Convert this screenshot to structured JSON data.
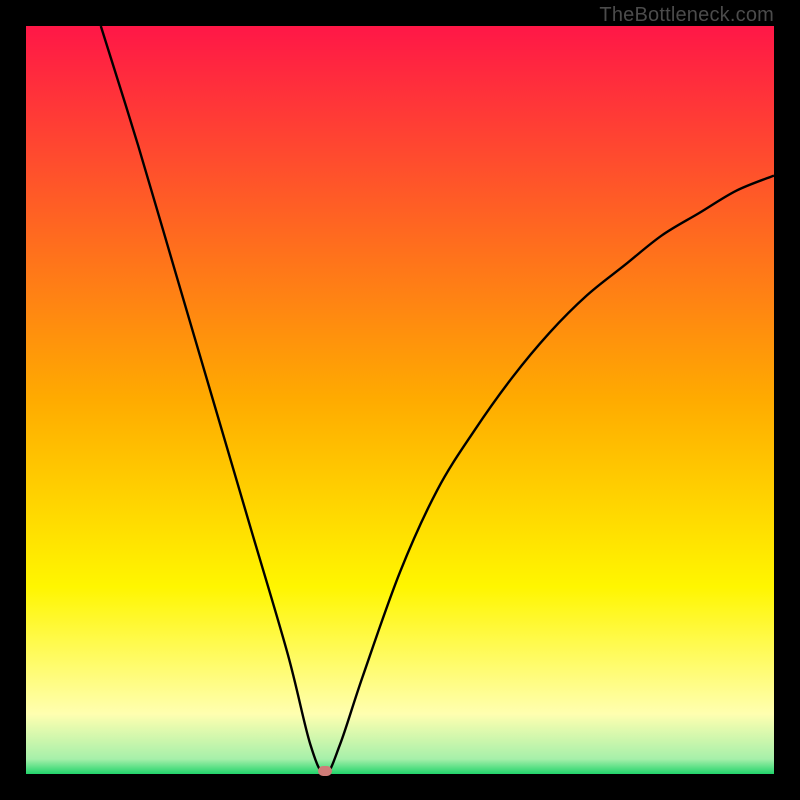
{
  "watermark": "TheBottleneck.com",
  "chart_data": {
    "type": "line",
    "title": "",
    "xlabel": "",
    "ylabel": "",
    "xlim": [
      0,
      100
    ],
    "ylim": [
      0,
      100
    ],
    "gradient": {
      "stops": [
        {
          "offset": 0,
          "color": "#ff1747"
        },
        {
          "offset": 50,
          "color": "#ffab00"
        },
        {
          "offset": 75,
          "color": "#fff600"
        },
        {
          "offset": 92,
          "color": "#ffffb0"
        },
        {
          "offset": 98,
          "color": "#a6f0aa"
        },
        {
          "offset": 100,
          "color": "#22d36b"
        }
      ]
    },
    "curve": {
      "description": "V-shaped bottleneck curve; y is mismatch percentage, x is relative component power. Minimum near x≈40.",
      "x": [
        10,
        15,
        20,
        25,
        30,
        35,
        38,
        40,
        42,
        45,
        50,
        55,
        60,
        65,
        70,
        75,
        80,
        85,
        90,
        95,
        100
      ],
      "y": [
        100,
        84,
        67,
        50,
        33,
        16,
        4,
        0,
        4,
        13,
        27,
        38,
        46,
        53,
        59,
        64,
        68,
        72,
        75,
        78,
        80
      ]
    },
    "marker": {
      "x": 40,
      "y": 0
    }
  }
}
